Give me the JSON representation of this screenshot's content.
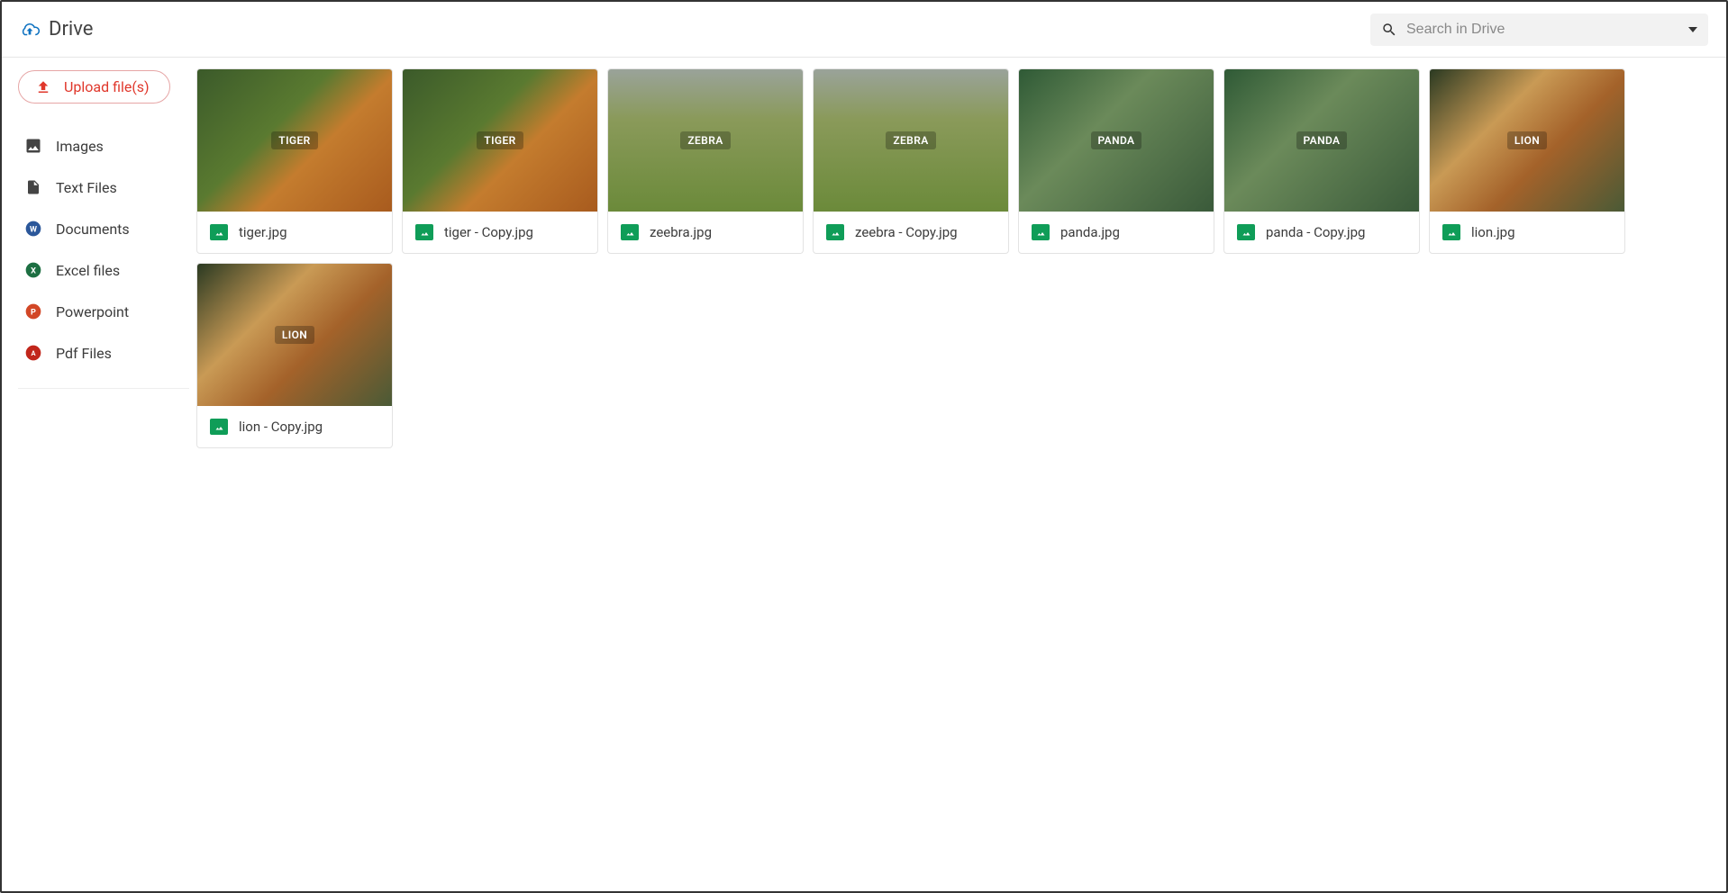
{
  "app": {
    "title": "Drive"
  },
  "search": {
    "placeholder": "Search in Drive"
  },
  "upload": {
    "label": "Upload file(s)"
  },
  "sidebar": {
    "items": [
      {
        "label": "Images",
        "icon": "image-icon",
        "color": "#444444"
      },
      {
        "label": "Text Files",
        "icon": "file-icon",
        "color": "#444444"
      },
      {
        "label": "Documents",
        "icon": "word-icon",
        "color": "#2b579a"
      },
      {
        "label": "Excel files",
        "icon": "excel-icon",
        "color": "#1d6f42"
      },
      {
        "label": "Powerpoint",
        "icon": "ppt-icon",
        "color": "#d24726"
      },
      {
        "label": "Pdf Files",
        "icon": "pdf-icon",
        "color": "#c1261b"
      }
    ]
  },
  "files": [
    {
      "name": "tiger.jpg",
      "thumb": "tiger"
    },
    {
      "name": "tiger - Copy.jpg",
      "thumb": "tiger"
    },
    {
      "name": "zeebra.jpg",
      "thumb": "zebra"
    },
    {
      "name": "zeebra - Copy.jpg",
      "thumb": "zebra"
    },
    {
      "name": "panda.jpg",
      "thumb": "panda"
    },
    {
      "name": "panda - Copy.jpg",
      "thumb": "panda"
    },
    {
      "name": "lion.jpg",
      "thumb": "lion"
    },
    {
      "name": "lion - Copy.jpg",
      "thumb": "lion"
    }
  ]
}
